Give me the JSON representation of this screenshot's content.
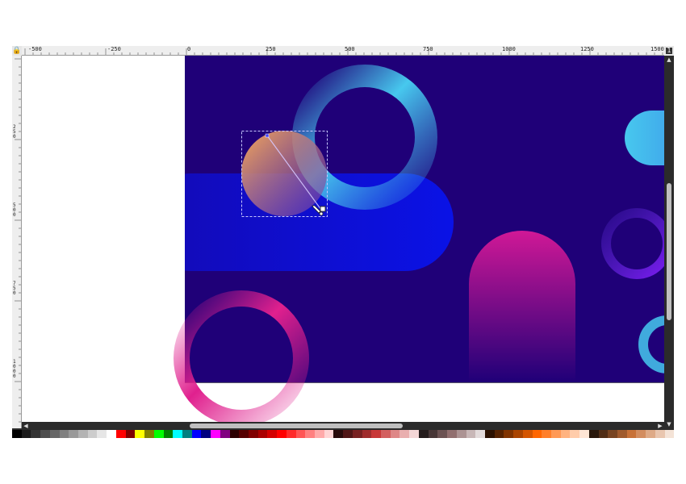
{
  "ruler": {
    "corner_icon": "lock-icon",
    "toggle_label": "1",
    "horizontal_labels": [
      "-500",
      "-250",
      "0",
      "250",
      "500",
      "750",
      "1000",
      "1250",
      "1500"
    ],
    "vertical_labels": [
      "250",
      "500",
      "750",
      "1000"
    ]
  },
  "colors": {
    "page_background": "#1f0078",
    "canvas_background": "#ffffff",
    "blue_pill": "#0a12e6",
    "pink_arch_top": "#d01896",
    "ring_cyan": "#47c8ee",
    "ring_pink": "#e0208e",
    "orb_top": "#f6a85a",
    "orb_bottom": "#6a3bb0",
    "selection": "#c8c8ff"
  },
  "scrollbars": {
    "vertical": {
      "up_icon": "▲",
      "down_icon": "▼"
    },
    "horizontal": {
      "left_icon": "◀",
      "right_icon": "▶"
    }
  },
  "palette": {
    "swatches": [
      "#000000",
      "#1a1a1a",
      "#333333",
      "#4d4d4d",
      "#666666",
      "#808080",
      "#999999",
      "#b3b3b3",
      "#cccccc",
      "#e6e6e6",
      "#ffffff",
      "#ff0000",
      "#800000",
      "#ffff00",
      "#808000",
      "#00ff00",
      "#008000",
      "#00ffff",
      "#008080",
      "#0000ff",
      "#000080",
      "#ff00ff",
      "#800080",
      "#2b0000",
      "#550000",
      "#800000",
      "#aa0000",
      "#d40000",
      "#ff0000",
      "#ff2a2a",
      "#ff5555",
      "#ff8080",
      "#ffaaaa",
      "#ffd5d5",
      "#280b0b",
      "#501616",
      "#782121",
      "#a02c2c",
      "#c83737",
      "#d35f5f",
      "#de8787",
      "#e9afaf",
      "#f4d7d7",
      "#241c1c",
      "#483737",
      "#6c5353",
      "#916f6f",
      "#ac9393",
      "#c8b7b7",
      "#e3dbdb",
      "#2b1100",
      "#552200",
      "#803300",
      "#aa4400",
      "#d45500",
      "#ff6600",
      "#ff7f2a",
      "#ff9955",
      "#ffb380",
      "#ffccaa",
      "#ffe6d5",
      "#28170b",
      "#502d16",
      "#784421",
      "#a05a2c",
      "#c87137",
      "#d38d5f",
      "#deaa87",
      "#e9c6af",
      "#f4e3d7"
    ]
  }
}
